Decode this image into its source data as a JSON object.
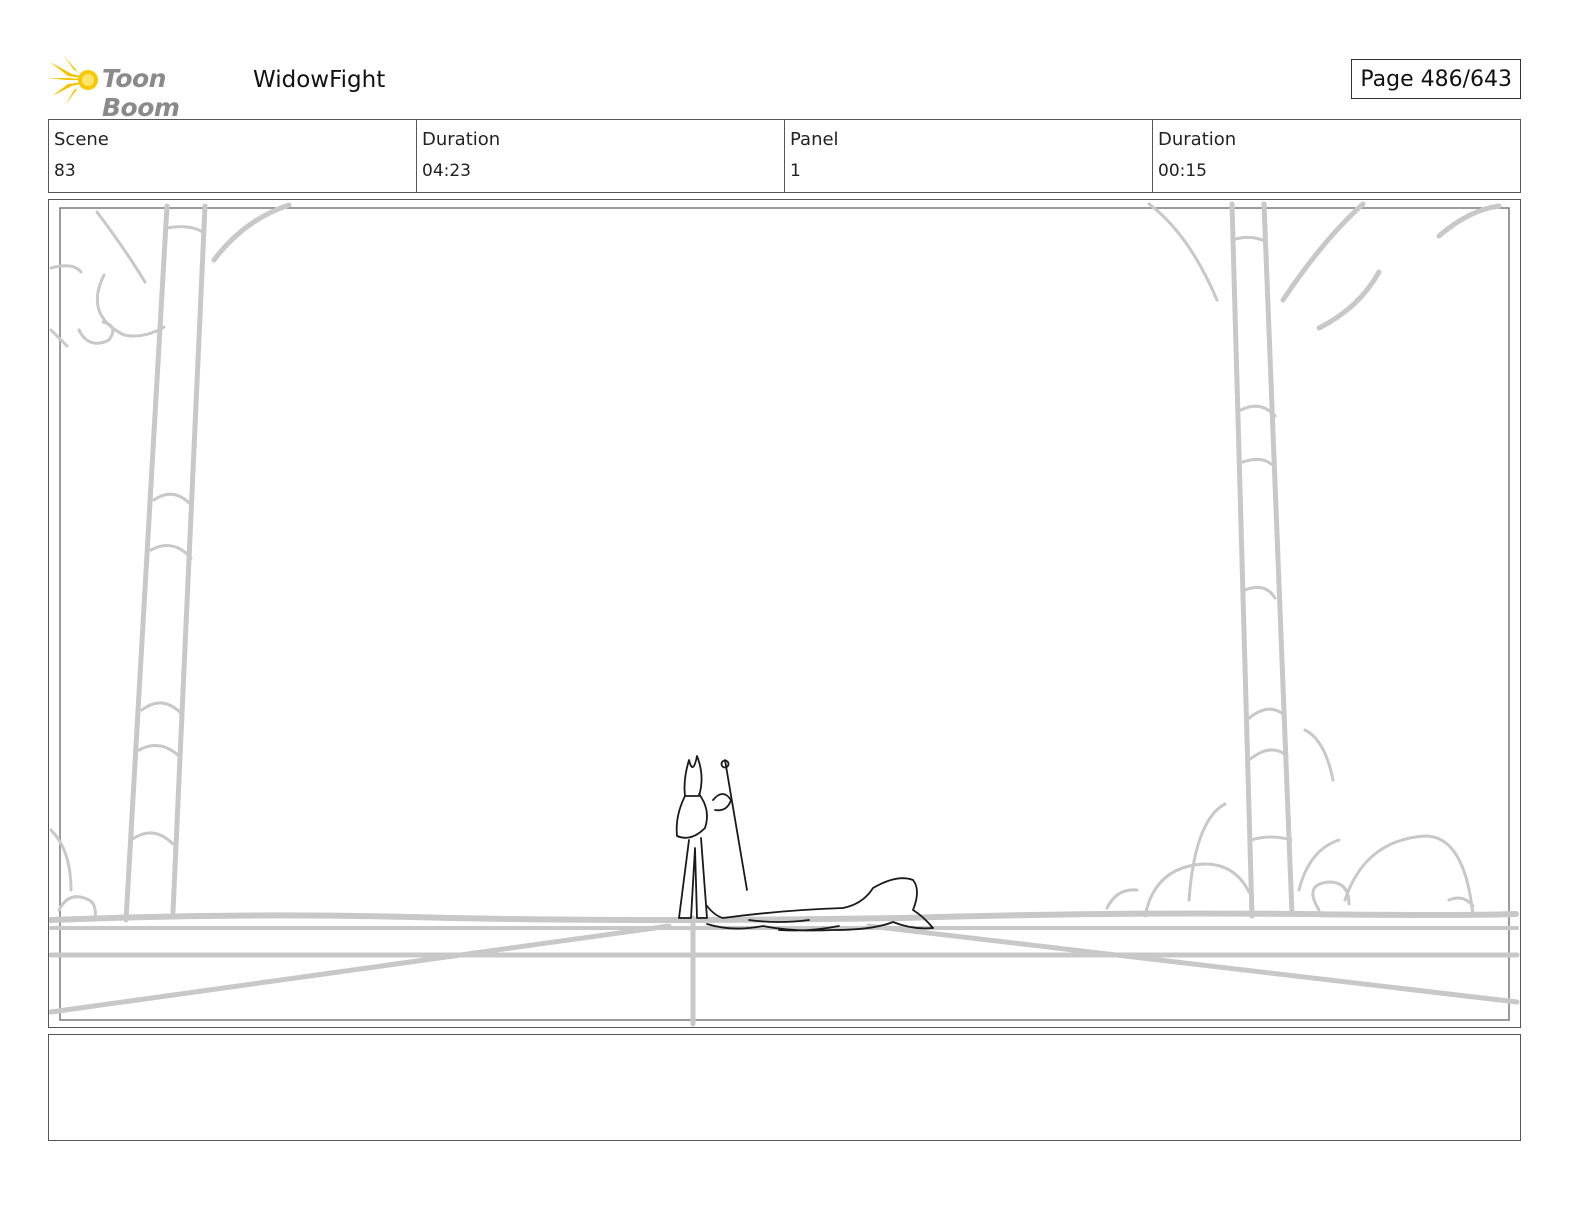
{
  "header": {
    "logo_text": "Toon Boom",
    "project_title": "WidowFight",
    "page_label": "Page 486/643"
  },
  "info": {
    "scene_label": "Scene",
    "scene_value": "83",
    "scene_duration_label": "Duration",
    "scene_duration_value": "04:23",
    "panel_label": "Panel",
    "panel_value": "1",
    "panel_duration_label": "Duration",
    "panel_duration_value": "00:15"
  },
  "colors": {
    "logo_yellow": "#f5c400",
    "sketch_gray": "#c8c8c8",
    "sketch_dark": "#1a1a1a"
  },
  "notes": {}
}
